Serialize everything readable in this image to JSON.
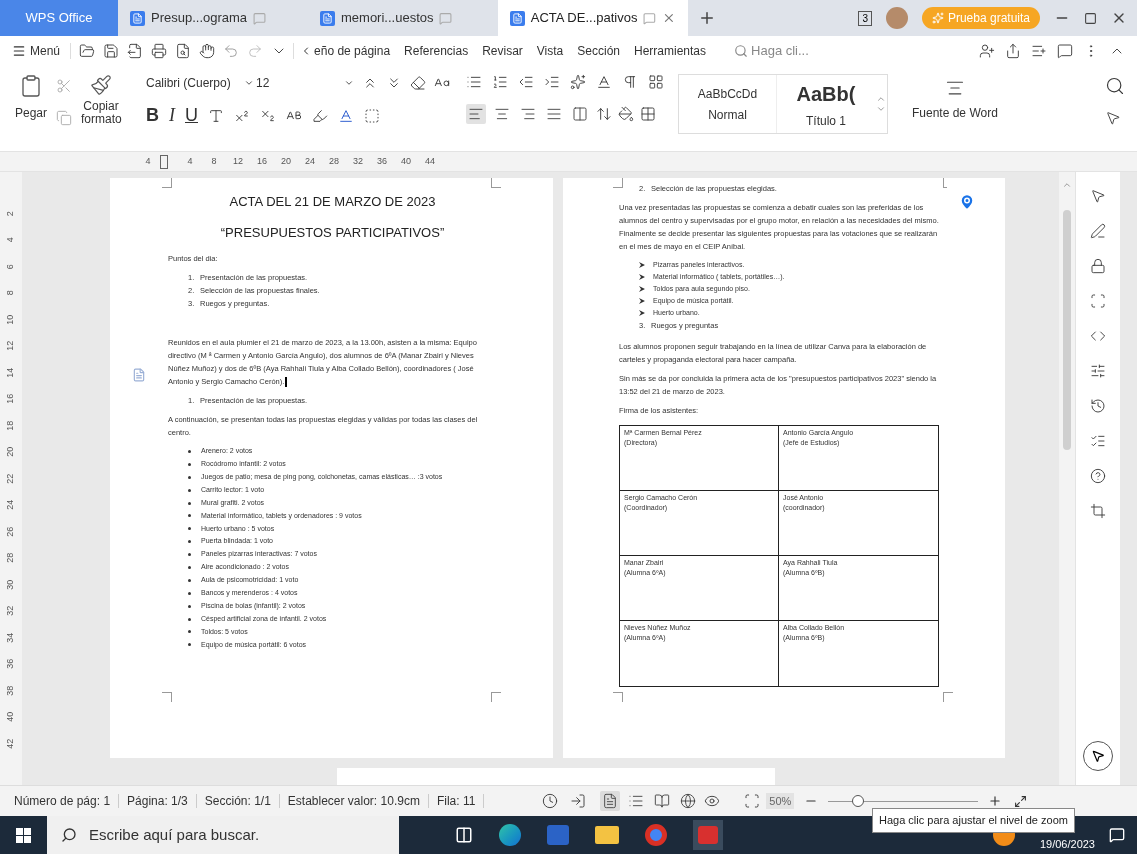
{
  "tabs": [
    {
      "kind": "home",
      "label": "WPS Office",
      "selected": false
    },
    {
      "kind": "doc",
      "label": "Presup...ograma",
      "selected": false
    },
    {
      "kind": "doc",
      "label": "memori...uestos",
      "selected": false
    },
    {
      "kind": "doc",
      "label": "ACTA DE...pativos",
      "selected": true
    }
  ],
  "title_bar": {
    "window_count": "3",
    "trial_button": "Prueba gratuita"
  },
  "menu": {
    "label": "Menú",
    "items": [
      "eño de página",
      "Referencias",
      "Revisar",
      "Vista",
      "Sección",
      "Herramientas"
    ],
    "search_placeholder": "Haga cli..."
  },
  "ribbon": {
    "paste": "Pegar",
    "copy_format": "Copiar formato",
    "font": "Calibri (Cuerpo)",
    "size": "12",
    "bold": "B",
    "italic": "I",
    "underline": "U",
    "align": [
      {
        "selected": true
      },
      {
        "selected": false
      },
      {
        "selected": false
      },
      {
        "selected": false
      },
      {
        "selected": false
      }
    ],
    "styles": [
      {
        "preview": "AaBbCcDd",
        "name": "Normal"
      },
      {
        "preview": "AaBb(",
        "name": "Título 1"
      }
    ],
    "word_font": "Fuente de Word"
  },
  "ruler": {
    "left_mark": "4",
    "ticks": [
      "4",
      "8",
      "12",
      "16",
      "20",
      "24",
      "28",
      "32",
      "36",
      "40",
      "44"
    ],
    "vertical": [
      "2",
      "4",
      "6",
      "8",
      "10",
      "12",
      "14",
      "16",
      "18",
      "20",
      "22",
      "24",
      "26",
      "28",
      "30",
      "32",
      "34",
      "36",
      "38",
      "40",
      "42"
    ]
  },
  "left_page": {
    "title": "ACTA DEL 21 DE MARZO DE 2023",
    "subtitle": "“PRESUPUESTOS PARTICIPATIVOS”",
    "agenda_label": "Puntos del dia:",
    "agenda": [
      {
        "number": "1.",
        "text": "Presentación de las propuestas."
      },
      {
        "number": "2.",
        "text": "Selección de las propuestas finales."
      },
      {
        "number": "3.",
        "text": "Ruegos y preguntas."
      }
    ],
    "intro": "Reunidos en el aula plumier el 21 de marzo de 2023, a la 13.00h, asisten a la misma: Equipo directivo (M ª Carmen y Antonio García Angulo), dos alumnos de 6ºA (Manar Zbairi y Nieves Núñez Muñoz)  y dos de 6ºB (Aya Rahhali Tiula y Alba Collado Bellón), coordinadores ( José Antonio y Sergio Camacho Cerón).",
    "section": {
      "number": "1.",
      "text": "Presentación de las propuestas."
    },
    "section_text": "A continuación, se presentan todas las propuestas elegidas y válidas por todas las clases del centro.",
    "votes": [
      "Arenero: 2 votos",
      "Rocódromo infantil: 2 votos",
      "Juegos de patio; mesa de ping pong, colchonetas, camas elásticas… :3 votos",
      "Carrito lector: 1 voto",
      "Mural grafiti. 2 votos",
      "Material informático, tablets y ordenadores : 9 votos",
      "Huerto urbano : 5 votos",
      "Puerta blindada: 1 voto",
      "Paneles pizarras interactivas: 7 votos",
      "Aire acondicionado : 2 votos",
      "Aula de psicomotricidad: 1 voto",
      "Bancos y merenderos : 4 votos",
      "Piscina de bolas (infantil): 2 votos",
      "Césped artificial zona de infantil. 2 votos",
      "Toldos: 5 votos",
      "Equipo de música portátil: 6 votos"
    ]
  },
  "right_page": {
    "section": {
      "number": "2.",
      "text": "Selección de las propuestas elegidas."
    },
    "paragraph": "Una vez presentadas las propuestas se comienza a debatir cuales son las preferidas de los alumnos del centro y supervisadas por  el grupo motor, en relación a las necesidades del mismo.  Finalmente se decide  presentar las siguientes propuestas  para las votaciones que  se realizarán en el mes de mayo en el CEIP Aníbal.",
    "chosen": [
      "Pizarras paneles interactivos.",
      "Material informático ( tablets, portátiles…).",
      "Toldos para aula segundo  piso.",
      "Equipo de música portátil.",
      "Huerto urbano."
    ],
    "section3": {
      "number": "3.",
      "text": "Ruegos y preguntas"
    },
    "canva": "Los alumnos  proponen  seguir trabajando en la línea de utilizar Canva para la elaboración de carteles y propaganda electoral para hacer campaña.",
    "closing": "Sin más se da por concluida la primera acta de los \"presupuestos  participativos 2023\" siendo la 13:52 del 21 de marzo de 2023.",
    "signatures_label": "Firma de los asistentes:",
    "signatures": [
      {
        "name": "Mª Carmen Bernal Pérez",
        "role": "(Directora)"
      },
      {
        "name": "Antonio García Angulo",
        "role": "(Jefe de Estudios)"
      },
      {
        "name": "Sergio Camacho  Cerón",
        "role": "(Coordinador)"
      },
      {
        "name": "José Antonio",
        "role": "(coordinador)"
      },
      {
        "name": "Manar Zbairi",
        "role": "(Alumna 6ºA)"
      },
      {
        "name": "Aya Rahhali Tiula",
        "role": "(Alumna 6ºB)"
      },
      {
        "name": "Nieves Núñez Muñoz",
        "role": "(Alumna 6ºA)"
      },
      {
        "name": "Alba Collado Bellón",
        "role": "(Alumna 6ºB)"
      }
    ]
  },
  "status_bar": {
    "items": [
      "Número de pág: 1",
      "Página: 1/3",
      "Sección: 1/1",
      "Establecer valor: 10.9cm",
      "Fila: 11"
    ],
    "view_modes": [
      {
        "selected": true
      },
      {
        "selected": false
      },
      {
        "selected": false
      },
      {
        "selected": false
      }
    ],
    "zoom": "50%",
    "level": 0.2
  },
  "taskbar": {
    "search_placeholder": "Escribe aquí para buscar.",
    "date": "19/06/2023"
  },
  "tooltip": "Haga clic para ajustar el nivel de zoom"
}
